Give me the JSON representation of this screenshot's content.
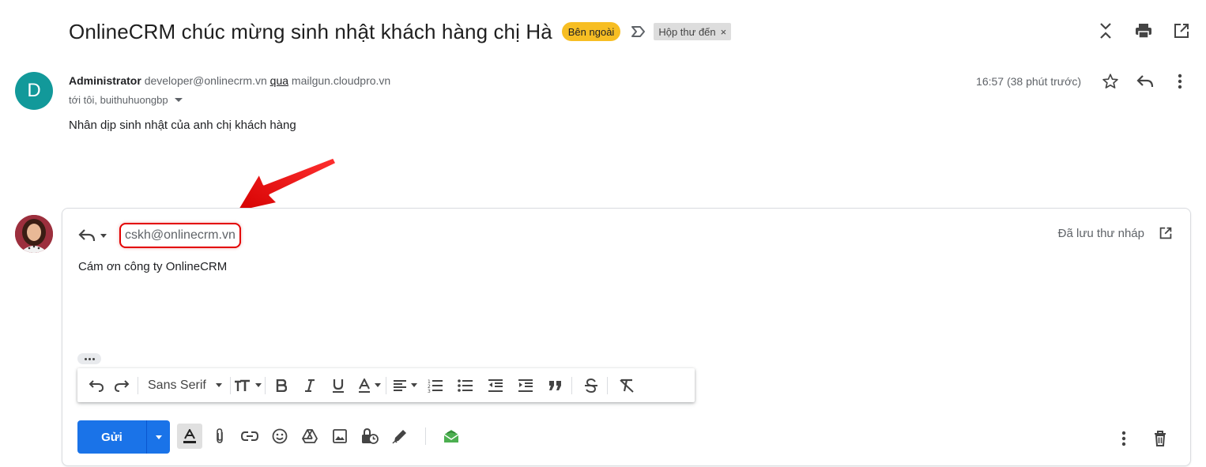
{
  "thread": {
    "subject": "OnlineCRM chúc mừng sinh nhật khách hàng chị Hà",
    "labels": [
      {
        "text": "Bên ngoài",
        "color": "#f7be23"
      },
      {
        "text": "Hộp thư đến",
        "remove": "×",
        "color": "#dddddd"
      }
    ],
    "icons": [
      "expand-collapse-icon",
      "print-icon",
      "open-new-window-icon"
    ]
  },
  "message": {
    "avatar_letter": "D",
    "avatar_color": "#12999a",
    "sender_name": "Administrator",
    "sender_email": "developer@onlinecrm.vn",
    "via_label": "qua",
    "via_domain": "mailgun.cloudpro.vn",
    "recipients": "tới tôi, buithuhuongbp",
    "time": "16:57 (38 phút trước)",
    "body": "Nhân dịp sinh nhật của anh chị khách hàng"
  },
  "reply": {
    "recipient": "cskh@onlinecrm.vn",
    "draft_status": "Đã lưu thư nháp",
    "body": "Cám ơn công ty OnlineCRM",
    "font": "Sans Serif",
    "send_label": "Gửi",
    "highlight_color": "#e30000",
    "send_color": "#1a73e8"
  }
}
